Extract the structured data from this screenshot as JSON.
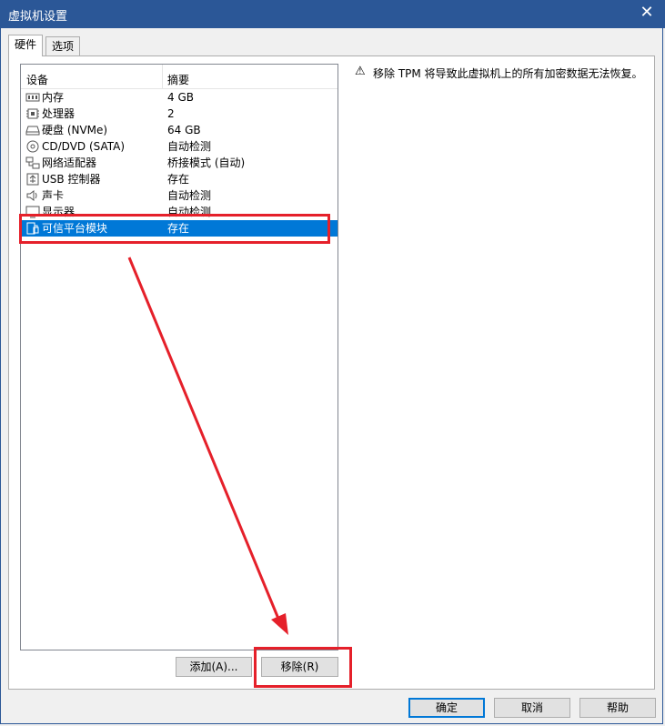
{
  "window": {
    "title": "虚拟机设置",
    "close_glyph": "✕"
  },
  "tabs": [
    {
      "label": "硬件"
    },
    {
      "label": "选项"
    }
  ],
  "list": {
    "col_device": "设备",
    "col_summary": "摘要",
    "rows": [
      {
        "icon": "memory-icon",
        "name": "内存",
        "summary": "4 GB"
      },
      {
        "icon": "cpu-icon",
        "name": "处理器",
        "summary": "2"
      },
      {
        "icon": "harddisk-icon",
        "name": "硬盘 (NVMe)",
        "summary": "64 GB"
      },
      {
        "icon": "cd-icon",
        "name": "CD/DVD (SATA)",
        "summary": "自动检测"
      },
      {
        "icon": "network-icon",
        "name": "网络适配器",
        "summary": "桥接模式 (自动)"
      },
      {
        "icon": "usb-icon",
        "name": "USB 控制器",
        "summary": "存在"
      },
      {
        "icon": "speaker-icon",
        "name": "声卡",
        "summary": "自动检测"
      },
      {
        "icon": "monitor-icon",
        "name": "显示器",
        "summary": "自动检测"
      },
      {
        "icon": "tpm-icon",
        "name": "可信平台模块",
        "summary": "存在",
        "selected": true
      }
    ]
  },
  "warning": {
    "icon": "warning-icon",
    "text": "移除 TPM 将导致此虚拟机上的所有加密数据无法恢复。"
  },
  "buttons": {
    "add": "添加(A)...",
    "remove": "移除(R)",
    "ok": "确定",
    "cancel": "取消",
    "help": "帮助"
  },
  "colors": {
    "titlebar": "#2b5797",
    "selection": "#0078d7",
    "annotation": "#e5202a"
  }
}
